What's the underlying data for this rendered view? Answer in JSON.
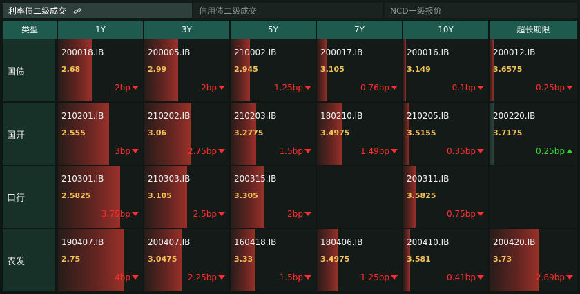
{
  "tabs": [
    {
      "label": "利率债二级成交",
      "active": true
    },
    {
      "label": "信用债二级成交",
      "active": false
    },
    {
      "label": "NCD一级报价",
      "active": false
    }
  ],
  "header": {
    "type_label": "类型",
    "tenors": [
      "1Y",
      "3Y",
      "5Y",
      "7Y",
      "10Y",
      "超长期限"
    ]
  },
  "colors": {
    "accent_header": "#1e5b4e",
    "yield": "#f3c15a",
    "down": "#ff2e2e",
    "up": "#35d23c"
  },
  "rows": [
    {
      "label": "国债",
      "cells": [
        {
          "code": "200018.IB",
          "yield": "2.68",
          "change": "2bp",
          "direction": "down",
          "bar_fraction": 0.4
        },
        {
          "code": "200005.IB",
          "yield": "2.99",
          "change": "2bp",
          "direction": "down",
          "bar_fraction": 0.4
        },
        {
          "code": "210002.IB",
          "yield": "2.945",
          "change": "1.25bp",
          "direction": "down",
          "bar_fraction": 0.23
        },
        {
          "code": "200017.IB",
          "yield": "3.105",
          "change": "0.76bp",
          "direction": "down",
          "bar_fraction": 0.12
        },
        {
          "code": "200016.IB",
          "yield": "3.149",
          "change": "0.1bp",
          "direction": "down",
          "bar_fraction": 0.03
        },
        {
          "code": "200012.IB",
          "yield": "3.6575",
          "change": "0.25bp",
          "direction": "down",
          "bar_fraction": 0.05
        }
      ]
    },
    {
      "label": "国开",
      "cells": [
        {
          "code": "210201.IB",
          "yield": "2.555",
          "change": "3bp",
          "direction": "down",
          "bar_fraction": 0.6
        },
        {
          "code": "210202.IB",
          "yield": "3.06",
          "change": "2.75bp",
          "direction": "down",
          "bar_fraction": 0.55
        },
        {
          "code": "210203.IB",
          "yield": "3.2775",
          "change": "1.5bp",
          "direction": "down",
          "bar_fraction": 0.3
        },
        {
          "code": "180210.IB",
          "yield": "3.4975",
          "change": "1.49bp",
          "direction": "down",
          "bar_fraction": 0.3
        },
        {
          "code": "210205.IB",
          "yield": "3.5155",
          "change": "0.35bp",
          "direction": "down",
          "bar_fraction": 0.07
        },
        {
          "code": "200220.IB",
          "yield": "3.7175",
          "change": "0.25bp",
          "direction": "up",
          "bar_fraction": 0.05
        }
      ]
    },
    {
      "label": "口行",
      "cells": [
        {
          "code": "210301.IB",
          "yield": "2.5825",
          "change": "3.75bp",
          "direction": "down",
          "bar_fraction": 0.73
        },
        {
          "code": "210303.IB",
          "yield": "3.105",
          "change": "2.5bp",
          "direction": "down",
          "bar_fraction": 0.5
        },
        {
          "code": "200315.IB",
          "yield": "3.305",
          "change": "2bp",
          "direction": "down",
          "bar_fraction": 0.4
        },
        {
          "code": "",
          "yield": "",
          "change": "",
          "direction": "",
          "bar_fraction": 0
        },
        {
          "code": "200311.IB",
          "yield": "3.5825",
          "change": "0.75bp",
          "direction": "down",
          "bar_fraction": 0.15
        },
        {
          "code": "",
          "yield": "",
          "change": "",
          "direction": "",
          "bar_fraction": 0
        }
      ]
    },
    {
      "label": "农发",
      "cells": [
        {
          "code": "190407.IB",
          "yield": "2.75",
          "change": "4bp",
          "direction": "down",
          "bar_fraction": 0.78
        },
        {
          "code": "200407.IB",
          "yield": "3.0475",
          "change": "2.25bp",
          "direction": "down",
          "bar_fraction": 0.45
        },
        {
          "code": "160418.IB",
          "yield": "3.33",
          "change": "1.5bp",
          "direction": "down",
          "bar_fraction": 0.29
        },
        {
          "code": "180406.IB",
          "yield": "3.4975",
          "change": "1.25bp",
          "direction": "down",
          "bar_fraction": 0.25
        },
        {
          "code": "200410.IB",
          "yield": "3.581",
          "change": "0.41bp",
          "direction": "down",
          "bar_fraction": 0.08
        },
        {
          "code": "200420.IB",
          "yield": "3.73",
          "change": "2.89bp",
          "direction": "down",
          "bar_fraction": 0.57
        }
      ]
    }
  ]
}
